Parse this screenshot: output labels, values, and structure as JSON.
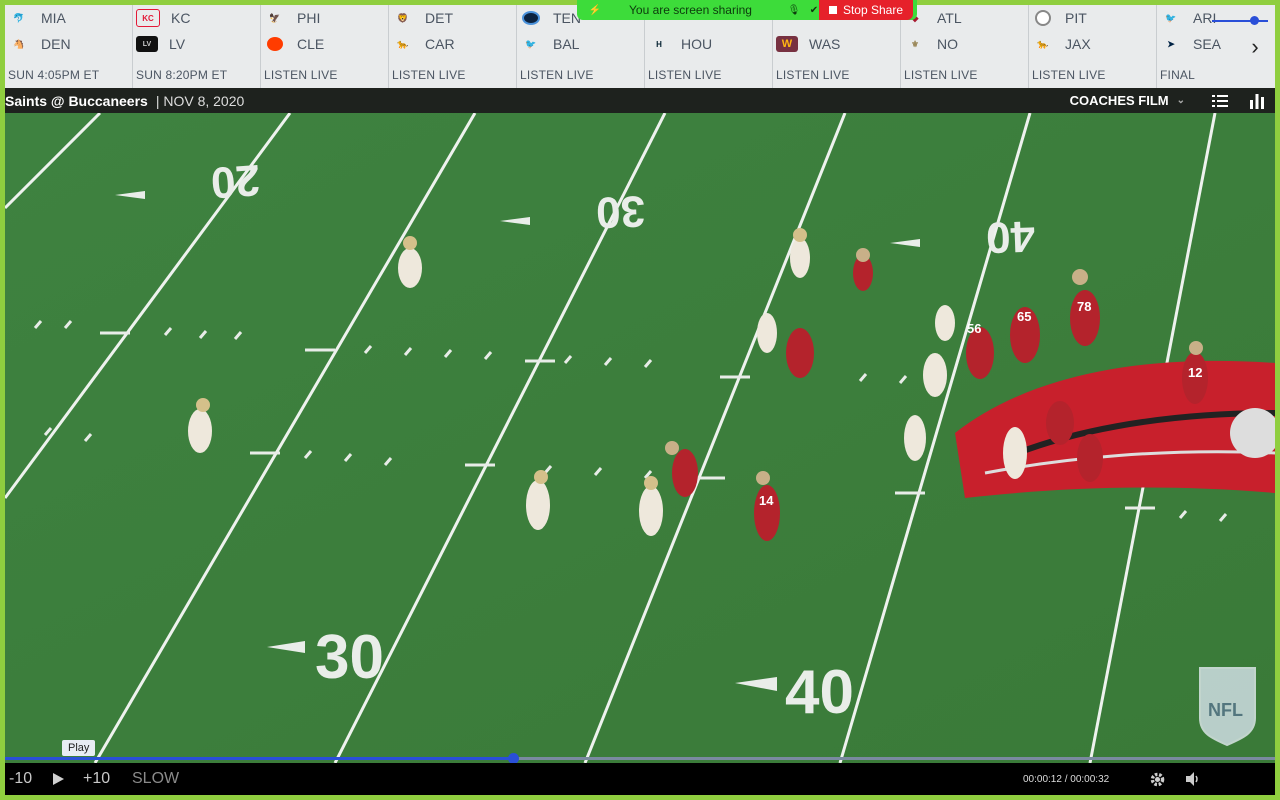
{
  "scoreboard": {
    "games": [
      {
        "away": "MIA",
        "home": "DEN",
        "status": "SUN 4:05PM ET",
        "away_color": "#27a2a8",
        "home_color": "#fb4f14"
      },
      {
        "away": "KC",
        "home": "LV",
        "status": "SUN 8:20PM ET",
        "away_color": "#e31837",
        "home_color": "#000000"
      },
      {
        "away": "PHI",
        "home": "CLE",
        "status": "LISTEN LIVE",
        "away_color": "#004c54",
        "home_color": "#ff3c00"
      },
      {
        "away": "DET",
        "home": "CAR",
        "status": "LISTEN LIVE",
        "away_color": "#0076b6",
        "home_color": "#0085ca"
      },
      {
        "away": "TEN",
        "home": "BAL",
        "status": "LISTEN LIVE",
        "away_color": "#0c2340",
        "home_color": "#241773"
      },
      {
        "away": "",
        "home": "HOU",
        "status": "LISTEN LIVE",
        "away_color": "#cccccc",
        "home_color": "#03202f"
      },
      {
        "away": "",
        "home": "WAS",
        "status": "LISTEN LIVE",
        "away_color": "#cccccc",
        "home_color": "#773141"
      },
      {
        "away": "ATL",
        "home": "NO",
        "status": "LISTEN LIVE",
        "away_color": "#a71930",
        "home_color": "#d3bc8d"
      },
      {
        "away": "PIT",
        "home": "JAX",
        "status": "LISTEN LIVE",
        "away_color": "#ffb612",
        "home_color": "#006778"
      },
      {
        "away": "ARI",
        "home": "SEA",
        "status": "FINAL",
        "away_color": "#97233f",
        "home_color": "#002244"
      }
    ],
    "next_icon": "chevron-right-icon"
  },
  "share_banner": {
    "text": "You are screen sharing",
    "stop_label": "Stop Share"
  },
  "video": {
    "matchup": "Saints @ Buccaneers",
    "date": "| NOV 8, 2020",
    "film_type": "COACHES FILM",
    "yard_numbers_top": [
      "20",
      "30",
      "40"
    ],
    "yard_numbers_bottom": [
      "30",
      "40"
    ],
    "jerseys": [
      "12",
      "14",
      "78",
      "65",
      "56"
    ],
    "watermark": "NFL"
  },
  "controls": {
    "rewind_label": "-10",
    "forward_label": "+10",
    "slow_label": "SLOW",
    "play_tooltip": "Play",
    "time": "00:00:12 / 00:00:32",
    "progress": 0.4,
    "volume": 0.75
  },
  "colors": {
    "progress": "#2a4fd8",
    "share_green": "#3ddc3a",
    "stop_red": "#e6212a",
    "border": "#8fce3f"
  }
}
